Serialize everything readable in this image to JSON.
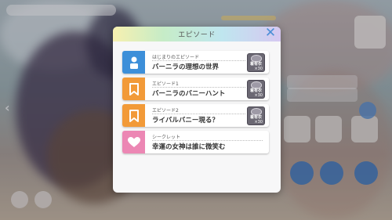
{
  "dialog": {
    "title": "エピソード",
    "close_icon": "close-icon"
  },
  "episodes": [
    {
      "subtitle": "はじまりのエピソード",
      "title": "バーニラの理想の世界",
      "icon": "person-icon",
      "color": "#3d8fd9",
      "reward": {
        "label": "着有衣",
        "count": "×30"
      }
    },
    {
      "subtitle": "エピソード1",
      "title": "バーニラのバニーハント",
      "icon": "bookmark-icon",
      "color": "#f29a38",
      "reward": {
        "label": "着有衣",
        "count": "×30"
      }
    },
    {
      "subtitle": "エピソード2",
      "title": "ライバルバニー現る？",
      "icon": "bookmark-icon",
      "color": "#f29a38",
      "reward": {
        "label": "着有衣",
        "count": "×30"
      }
    },
    {
      "subtitle": "シークレット",
      "title": "幸運の女神は誰に微笑む",
      "icon": "heart-icon",
      "color": "#ec87b4"
    }
  ]
}
